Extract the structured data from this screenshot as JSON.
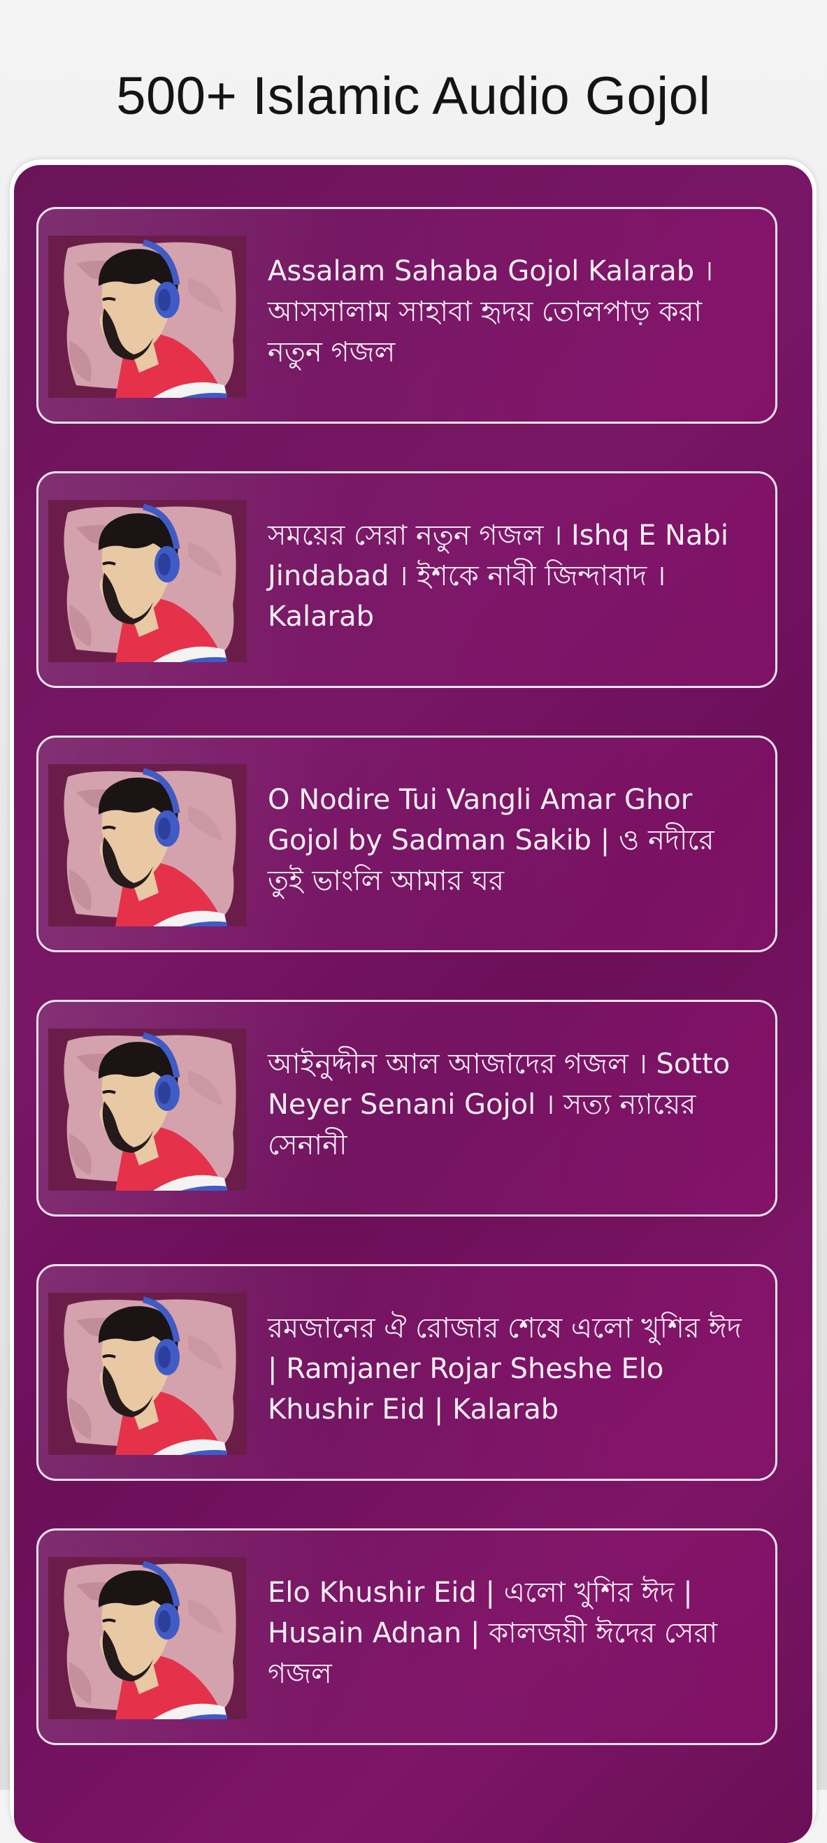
{
  "header": {
    "title": "500+ Islamic Audio Gojol"
  },
  "gojol_list": [
    {
      "title": "Assalam Sahaba Gojol Kalarab । আসসালাম সাহাবা হৃদয় তোলপাড় করা নতুন গজল",
      "thumbnail_icon": "singer-with-headphones-icon"
    },
    {
      "title": "সময়ের সেরা নতুন গজল । Ishq E Nabi Jindabad । ইশকে নাবী জিন্দাবাদ । Kalarab",
      "thumbnail_icon": "singer-with-headphones-icon"
    },
    {
      "title": "O Nodire Tui Vangli Amar Ghor Gojol by Sadman Sakib | ও নদীরে তুই ভাংলি আমার ঘর",
      "thumbnail_icon": "singer-with-headphones-icon"
    },
    {
      "title": "আইনুদ্দীন আল আজাদের গজল । Sotto Neyer Senani Gojol । সত্য ন্যায়ের সেনানী",
      "thumbnail_icon": "singer-with-headphones-icon"
    },
    {
      "title": "রমজানের ঐ রোজার শেষে এলো খুশির ঈদ | Ramjaner Rojar Sheshe Elo Khushir Eid | Kalarab",
      "thumbnail_icon": "singer-with-headphones-icon"
    },
    {
      "title": "Elo Khushir Eid | এলো খুশির ঈদ | Husain Adnan | কালজয়ী ঈদের সেরা গজল",
      "thumbnail_icon": "singer-with-headphones-icon"
    }
  ],
  "colors": {
    "panel_purple": "#6e1259",
    "card_border": "#f2e2ee",
    "text_light": "#f7eef6",
    "headphone_blue": "#3f5bc6",
    "shirt_red": "#e5324a"
  }
}
